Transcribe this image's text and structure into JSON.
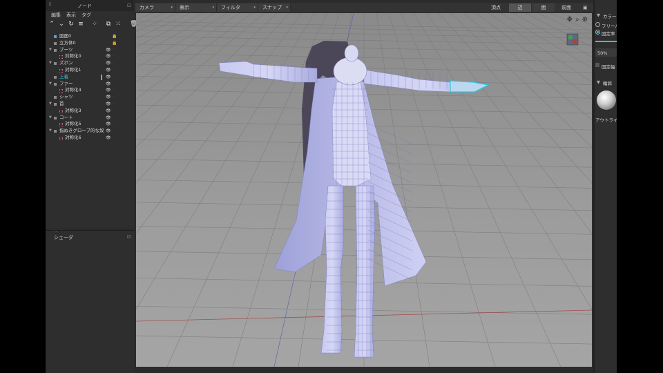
{
  "node_panel": {
    "title": "ノード",
    "menu": [
      "編集",
      "表示",
      "タグ"
    ],
    "tree": [
      {
        "label": "図面0",
        "depth": 1,
        "icon": "box",
        "expand": false,
        "eye": false,
        "lock": true
      },
      {
        "label": "立方体0",
        "depth": 1,
        "icon": "node",
        "expand": false,
        "eye": false,
        "lock": true
      },
      {
        "label": "ブーツ",
        "depth": 1,
        "icon": "node",
        "expand": true,
        "eye": true
      },
      {
        "label": "対称化0",
        "depth": 2,
        "icon": "mesh",
        "expand": false,
        "eye": true
      },
      {
        "label": "ズボン",
        "depth": 1,
        "icon": "node",
        "expand": true,
        "eye": true
      },
      {
        "label": "対称化1",
        "depth": 2,
        "icon": "mesh",
        "expand": false,
        "eye": true
      },
      {
        "label": "上着",
        "depth": 1,
        "icon": "node",
        "expand": false,
        "eye": true,
        "selected": true
      },
      {
        "label": "ファー",
        "depth": 1,
        "icon": "node",
        "expand": true,
        "eye": true
      },
      {
        "label": "対称化4",
        "depth": 2,
        "icon": "mesh",
        "expand": false,
        "eye": true
      },
      {
        "label": "シャツ",
        "depth": 1,
        "icon": "node",
        "expand": false,
        "eye": true
      },
      {
        "label": "首",
        "depth": 1,
        "icon": "node",
        "expand": true,
        "eye": true
      },
      {
        "label": "対称化3",
        "depth": 2,
        "icon": "mesh",
        "expand": false,
        "eye": true
      },
      {
        "label": "コート",
        "depth": 1,
        "icon": "node",
        "expand": true,
        "eye": true
      },
      {
        "label": "対称化5",
        "depth": 2,
        "icon": "mesh",
        "expand": false,
        "eye": true
      },
      {
        "label": "指ぬきグローブ的な奴",
        "depth": 1,
        "icon": "node",
        "expand": true,
        "eye": true
      },
      {
        "label": "対称化6",
        "depth": 2,
        "icon": "mesh",
        "expand": false,
        "eye": true
      }
    ]
  },
  "shader_panel": {
    "title": "シェーダ"
  },
  "viewport_toolbar": {
    "camera": "カメラ",
    "display": "表示",
    "filter": "フィルタ",
    "snap": "スナップ",
    "vertex": "頂点",
    "edge": "辺",
    "face": "面",
    "front": "前面"
  },
  "right_panel": {
    "section1": "カラー",
    "freehand": "フリーハン",
    "fixed_rate": "固定率",
    "percent": "50%",
    "fixed_width": "固定幅",
    "section2": "輪郭",
    "outline": "アウトライン"
  },
  "icons": {
    "toolbar": [
      "arrow-up-icon",
      "arrow-down-icon",
      "rotate-icon",
      "sort-icon",
      "grid-icon",
      "layers-icon",
      "duplicate-icon",
      "trash-icon"
    ],
    "nav": [
      "move-icon",
      "zoom-icon",
      "target-icon"
    ]
  },
  "colors": {
    "selection": "#29c7e8",
    "mesh": "#b5b8ee"
  }
}
